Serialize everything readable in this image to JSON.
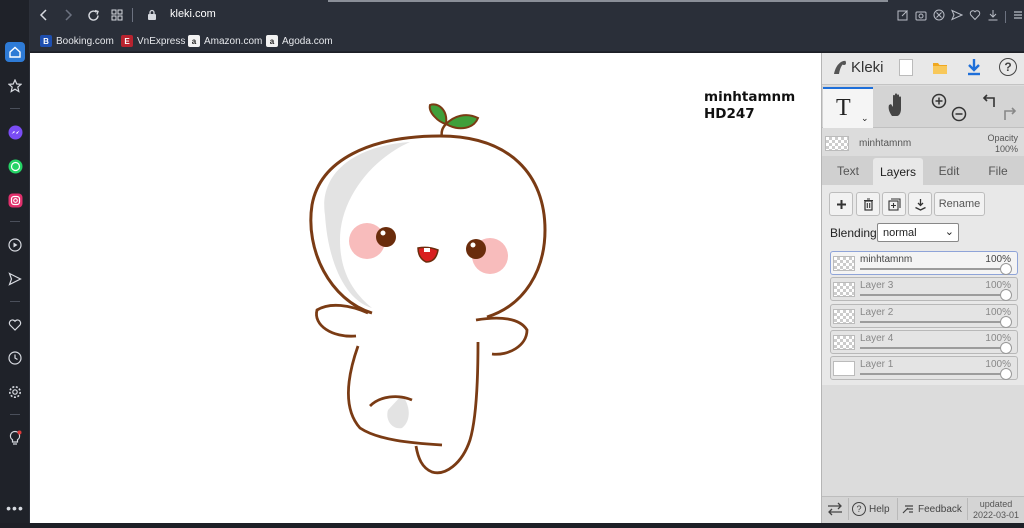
{
  "browser": {
    "url": "kleki.com",
    "bookmarks": [
      {
        "label": "Booking.com",
        "icon": "B",
        "color": "#1e4fb0"
      },
      {
        "label": "VnExpress",
        "icon": "E",
        "color": "#b8232f"
      },
      {
        "label": "Amazon.com",
        "icon": "a",
        "color": "#f2f2f2"
      },
      {
        "label": "Agoda.com",
        "icon": "a",
        "color": "#f2f2f2"
      }
    ]
  },
  "canvas": {
    "signature_line1": "minhtamnm",
    "signature_line2": "HD247"
  },
  "app": {
    "logo": "Kleki",
    "layer_name": "minhtamnm",
    "opacity_label": "Opacity",
    "opacity_value": "100%",
    "tabs": [
      "Text",
      "Layers",
      "Edit",
      "File"
    ],
    "active_tab": "Layers",
    "rename_label": "Rename",
    "blending_label": "Blending",
    "blending_value": "normal",
    "layers": [
      {
        "name": "minhtamnm",
        "opacity": "100%",
        "active": true
      },
      {
        "name": "Layer 3",
        "opacity": "100%",
        "active": false
      },
      {
        "name": "Layer 2",
        "opacity": "100%",
        "active": false
      },
      {
        "name": "Layer 4",
        "opacity": "100%",
        "active": false
      },
      {
        "name": "Layer 1",
        "opacity": "100%",
        "active": false
      }
    ],
    "footer": {
      "help": "Help",
      "feedback": "Feedback",
      "updated_label": "updated",
      "updated_date": "2022-03-01"
    }
  },
  "colors": {
    "accent": "#1e6fd9",
    "panel_bg": "#dcdcdc",
    "browser_bar": "#2a2f39"
  }
}
